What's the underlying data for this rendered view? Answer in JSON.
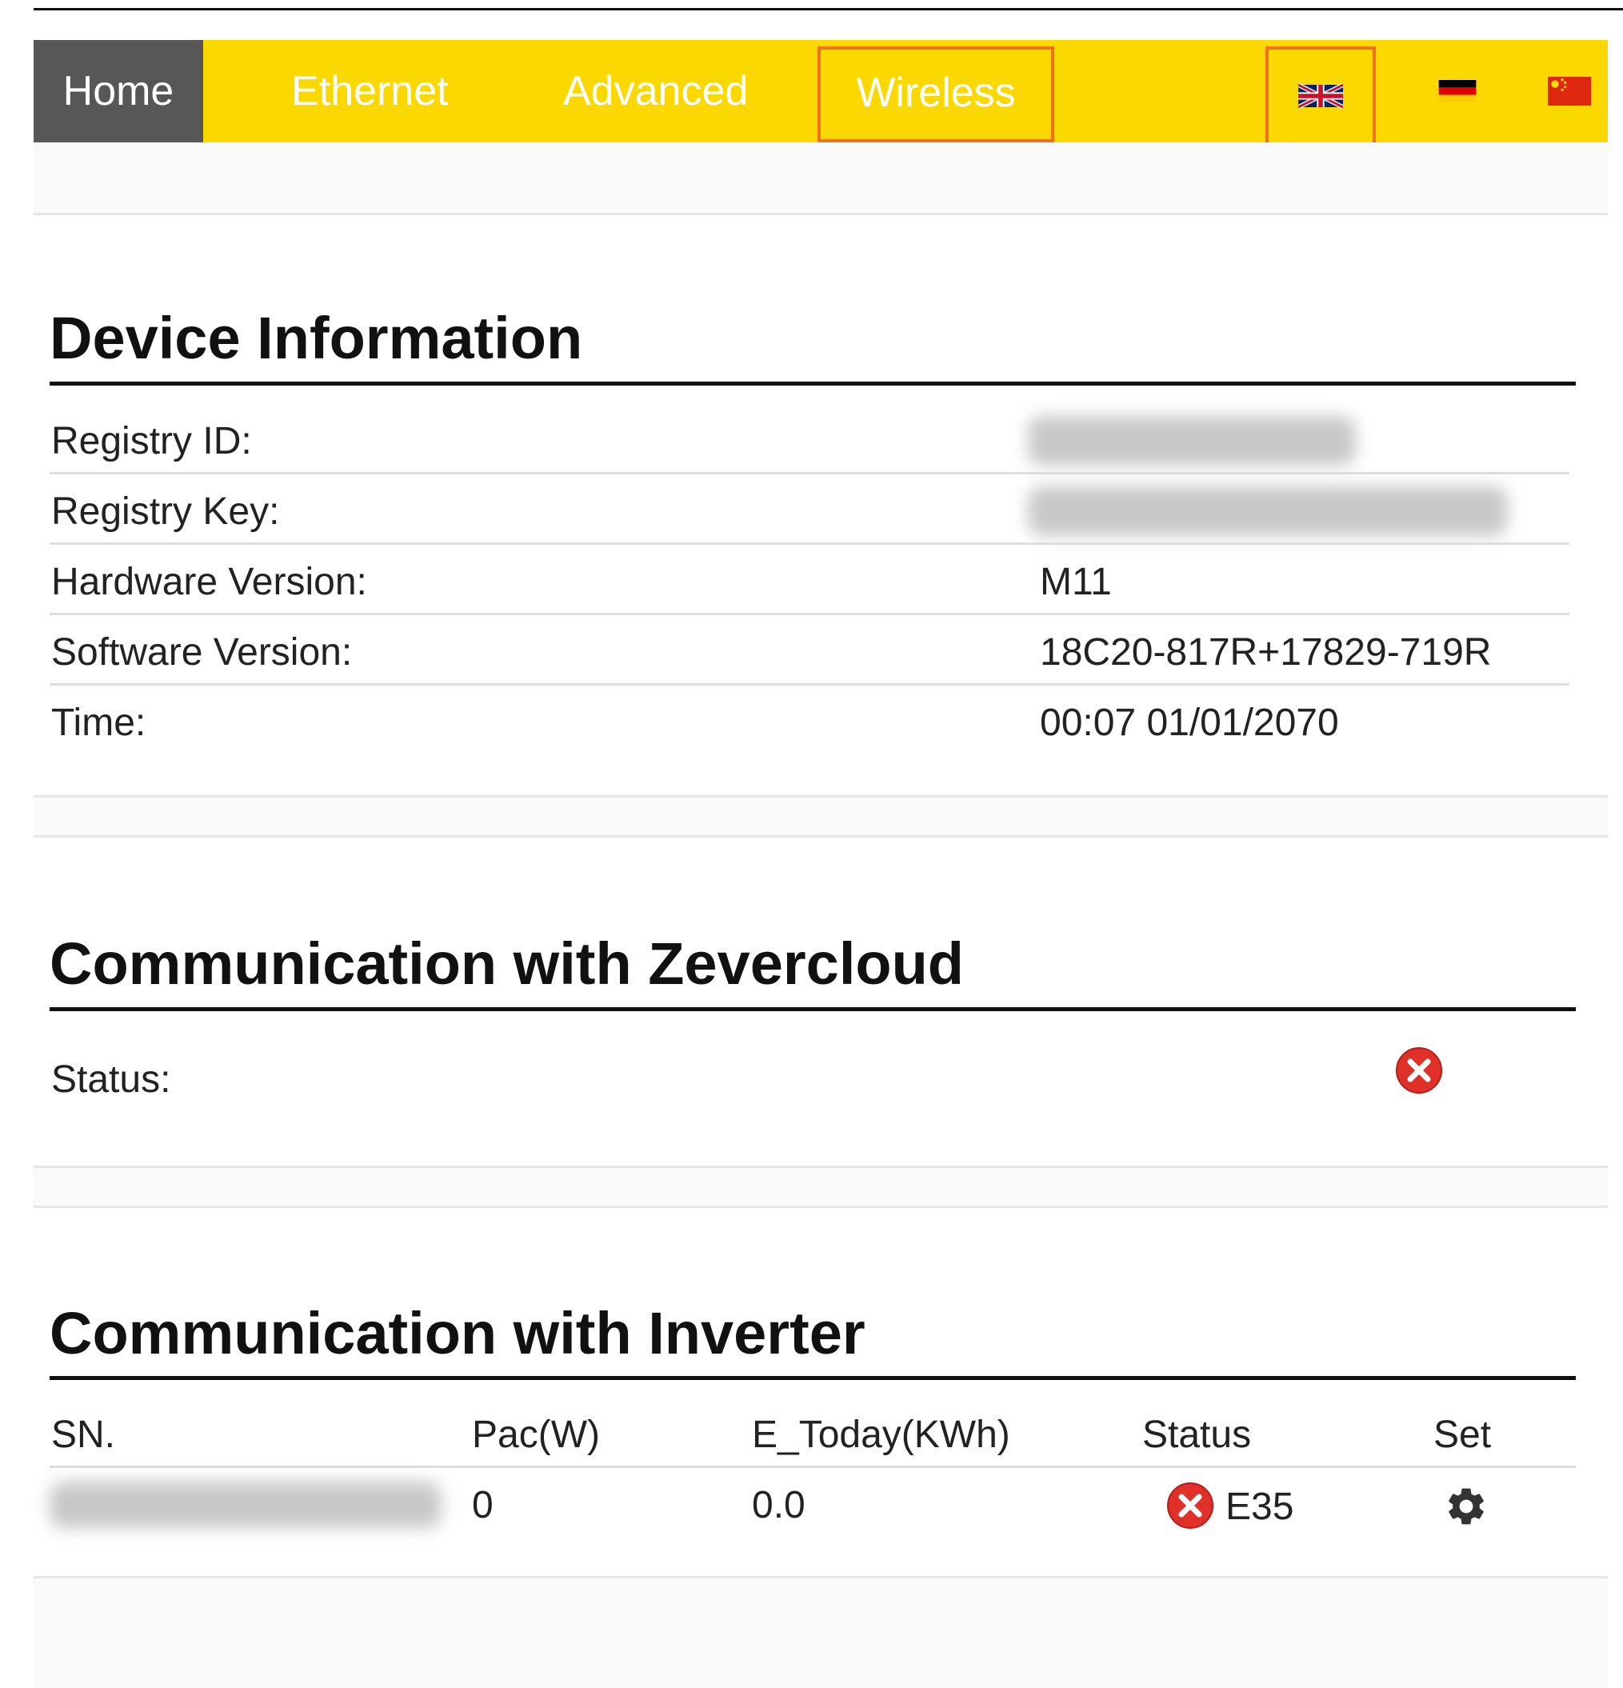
{
  "nav": {
    "items": [
      {
        "label": "Home"
      },
      {
        "label": "Ethernet"
      },
      {
        "label": "Advanced"
      },
      {
        "label": "Wireless"
      }
    ],
    "languages": [
      "uk-flag-icon",
      "germany-flag-icon",
      "china-flag-icon"
    ]
  },
  "device_info": {
    "title": "Device Information",
    "rows": [
      {
        "label": "Registry ID:",
        "value": ""
      },
      {
        "label": "Registry Key:",
        "value": ""
      },
      {
        "label": "Hardware Version:",
        "value": "M11"
      },
      {
        "label": "Software Version:",
        "value": "18C20-817R+17829-719R"
      },
      {
        "label": "Time:",
        "value": "00:07 01/01/2070"
      }
    ]
  },
  "cloud": {
    "title": "Communication with Zevercloud",
    "status_label": "Status:",
    "status_icon": "error-icon"
  },
  "inverter": {
    "title": "Communication with Inverter",
    "headers": [
      "SN.",
      "Pac(W)",
      "E_Today(KWh)",
      "Status",
      "Set"
    ],
    "row": {
      "sn": "",
      "pac": "0",
      "e_today": "0.0",
      "status": "E35",
      "set_icon": "gear-icon"
    }
  },
  "colors": {
    "navbar": "#fad800",
    "nav_active": "#575757",
    "highlight": "#f2711c",
    "error": "#e0302a"
  }
}
